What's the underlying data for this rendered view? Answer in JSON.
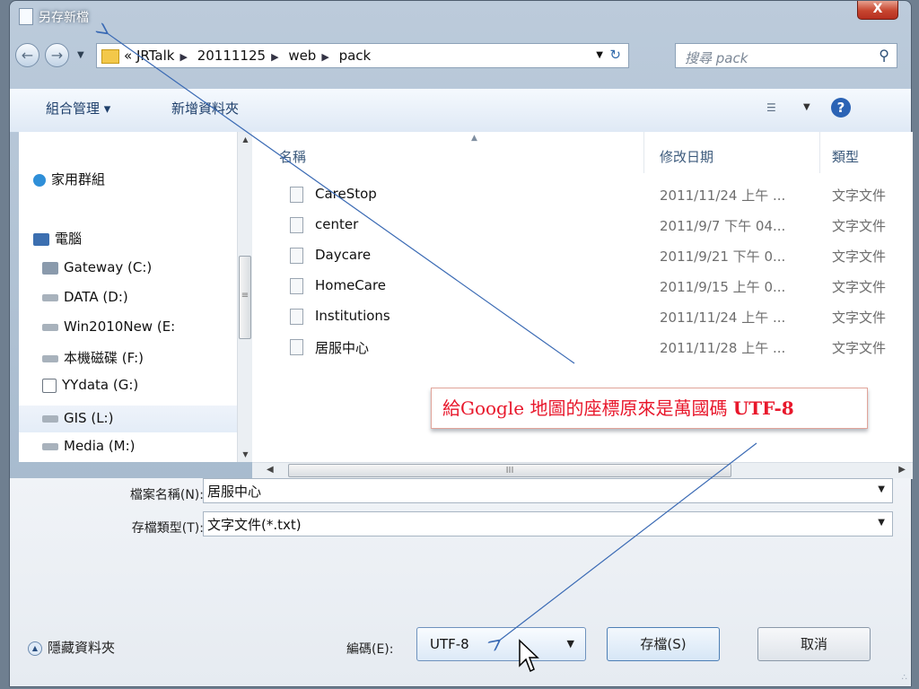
{
  "window": {
    "title": "另存新檔",
    "close_label": "X"
  },
  "nav": {
    "back_icon": "back-arrow-icon",
    "forward_icon": "forward-arrow-icon",
    "breadcrumb_prefix": "«",
    "crumbs": [
      "JRTalk",
      "20111125",
      "web",
      "pack"
    ],
    "search_placeholder": "搜尋 pack"
  },
  "toolbar": {
    "organize": "組合管理 ▾",
    "new_folder": "新增資料夾"
  },
  "sidebar": {
    "items": [
      {
        "label": "家用群組",
        "icon": "homegroup-icon",
        "color": "#2f8fd8"
      },
      {
        "label": "電腦",
        "icon": "computer-icon",
        "color": "#3c6fb0"
      },
      {
        "label": "Gateway (C:)",
        "icon": "system-drive-icon",
        "color": "#8a9aac"
      },
      {
        "label": "DATA (D:)",
        "icon": "drive-icon",
        "color": "#a8b2bc"
      },
      {
        "label": "Win2010New (E:",
        "icon": "drive-icon",
        "color": "#a8b2bc"
      },
      {
        "label": "本機磁碟 (F:)",
        "icon": "drive-icon",
        "color": "#a8b2bc"
      },
      {
        "label": "YYdata (G:)",
        "icon": "network-drive-icon",
        "color": "#9aa4ae"
      },
      {
        "label": "GIS (L:)",
        "icon": "drive-icon",
        "color": "#a8b2bc"
      },
      {
        "label": "Media (M:)",
        "icon": "drive-icon",
        "color": "#a8b2bc"
      }
    ]
  },
  "files": {
    "columns": {
      "name": "名稱",
      "date": "修改日期",
      "type": "類型"
    },
    "rows": [
      {
        "name": "CareStop",
        "date": "2011/11/24 上午 ...",
        "type": "文字文件"
      },
      {
        "name": "center",
        "date": "2011/9/7 下午 04...",
        "type": "文字文件"
      },
      {
        "name": "Daycare",
        "date": "2011/9/21 下午 0...",
        "type": "文字文件"
      },
      {
        "name": "HomeCare",
        "date": "2011/9/15 上午 0...",
        "type": "文字文件"
      },
      {
        "name": "Institutions",
        "date": "2011/11/24 上午 ...",
        "type": "文字文件"
      },
      {
        "name": "居服中心",
        "date": "2011/11/28 上午 ...",
        "type": "文字文件"
      }
    ]
  },
  "form": {
    "filename_label": "檔案名稱(N):",
    "filename_value": "居服中心",
    "filetype_label": "存檔類型(T):",
    "filetype_value": "文字文件(*.txt)",
    "hide_folders": "隱藏資料夾",
    "encoding_label": "編碼(E):",
    "encoding_value": "UTF-8",
    "save_button": "存檔(S)",
    "cancel_button": "取消"
  },
  "annotation": {
    "text_main": "給Google 地圖的座標原來是萬國碼 ",
    "text_bold": "UTF-8",
    "color": "#e8172b"
  }
}
